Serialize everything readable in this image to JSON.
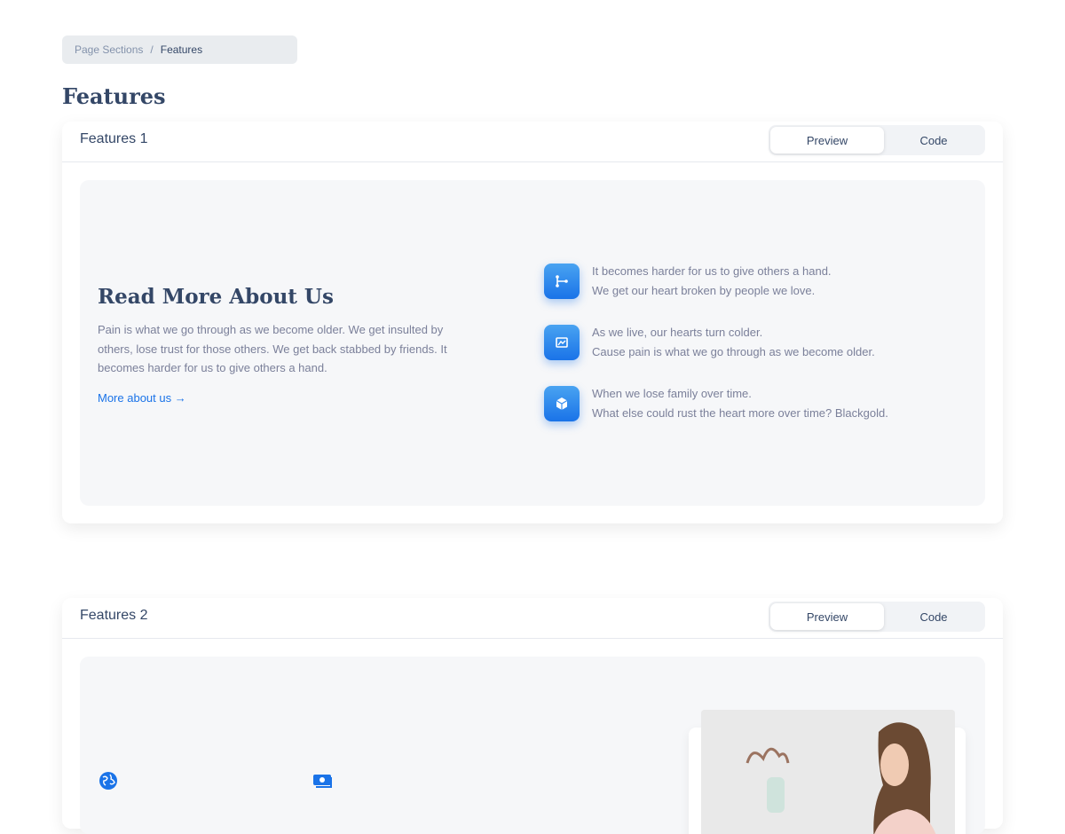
{
  "breadcrumb": {
    "parent": "Page Sections",
    "separator": "/",
    "current": "Features"
  },
  "page_title": "Features",
  "colors": {
    "accent": "#1A73E8",
    "heading": "#344767",
    "muted": "#7b809a"
  },
  "sections": [
    {
      "title": "Features 1",
      "tabs": {
        "preview": "Preview",
        "code": "Code"
      },
      "about": {
        "title": "Read More About Us",
        "text": "Pain is what we go through as we become older. We get insulted by others, lose trust for those others. We get back stabbed by friends. It becomes harder for us to give others a hand.",
        "link": "More about us →"
      },
      "features": [
        {
          "icon": "share-nodes-icon",
          "line1": "It becomes harder for us to give others a hand.",
          "line2": "We get our heart broken by people we love."
        },
        {
          "icon": "image-frame-icon",
          "line1": "As we live, our hearts turn colder.",
          "line2": "Cause pain is what we go through as we become older."
        },
        {
          "icon": "cube-icon",
          "line1": "When we lose family over time.",
          "line2": "What else could rust the heart more over time? Blackgold."
        }
      ]
    },
    {
      "title": "Features 2",
      "tabs": {
        "preview": "Preview",
        "code": "Code"
      },
      "icons": [
        "globe-icon",
        "money-icon"
      ]
    }
  ]
}
